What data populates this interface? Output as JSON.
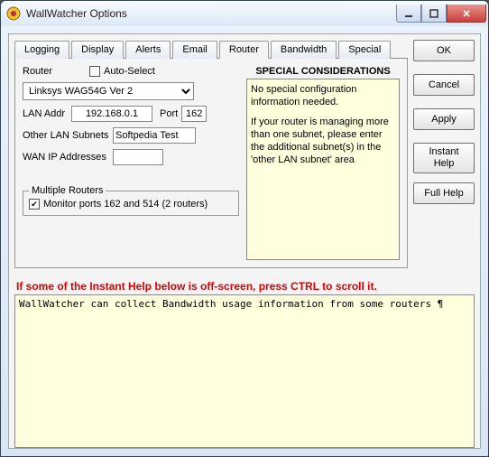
{
  "window": {
    "title": "WallWatcher Options"
  },
  "tabs": {
    "items": [
      "Logging",
      "Display",
      "Alerts",
      "Email",
      "Router",
      "Bandwidth",
      "Special"
    ],
    "active": "Router"
  },
  "buttons": {
    "ok": "OK",
    "cancel": "Cancel",
    "apply": "Apply",
    "instant_help": "Instant\nHelp",
    "full_help": "Full Help"
  },
  "router_form": {
    "router_label": "Router",
    "auto_select_label": "Auto-Select",
    "auto_select_checked": false,
    "router_value": "Linksys WAG54G Ver 2",
    "lan_addr_label": "LAN Addr",
    "lan_addr_value": "192.168.0.1",
    "port_label": "Port",
    "port_value": "162",
    "other_subnets_label": "Other LAN Subnets",
    "other_subnets_value": "Softpedia Test",
    "wan_ip_label": "WAN IP Addresses",
    "wan_ip_value": ""
  },
  "multi_routers": {
    "group_title": "Multiple Routers",
    "monitor_label": "Monitor ports 162 and 514 (2 routers)",
    "monitor_checked": true
  },
  "special": {
    "title": "SPECIAL CONSIDERATIONS",
    "para1": "No special configuration information needed.",
    "para2": "If your router is managing more than one subnet, please enter the additional subnet(s) in the 'other LAN subnet' area"
  },
  "help": {
    "red_notice": "If some of the Instant Help below is off-screen, press CTRL to scroll it.",
    "body": "WallWatcher can collect Bandwidth usage information from some routers ¶"
  }
}
